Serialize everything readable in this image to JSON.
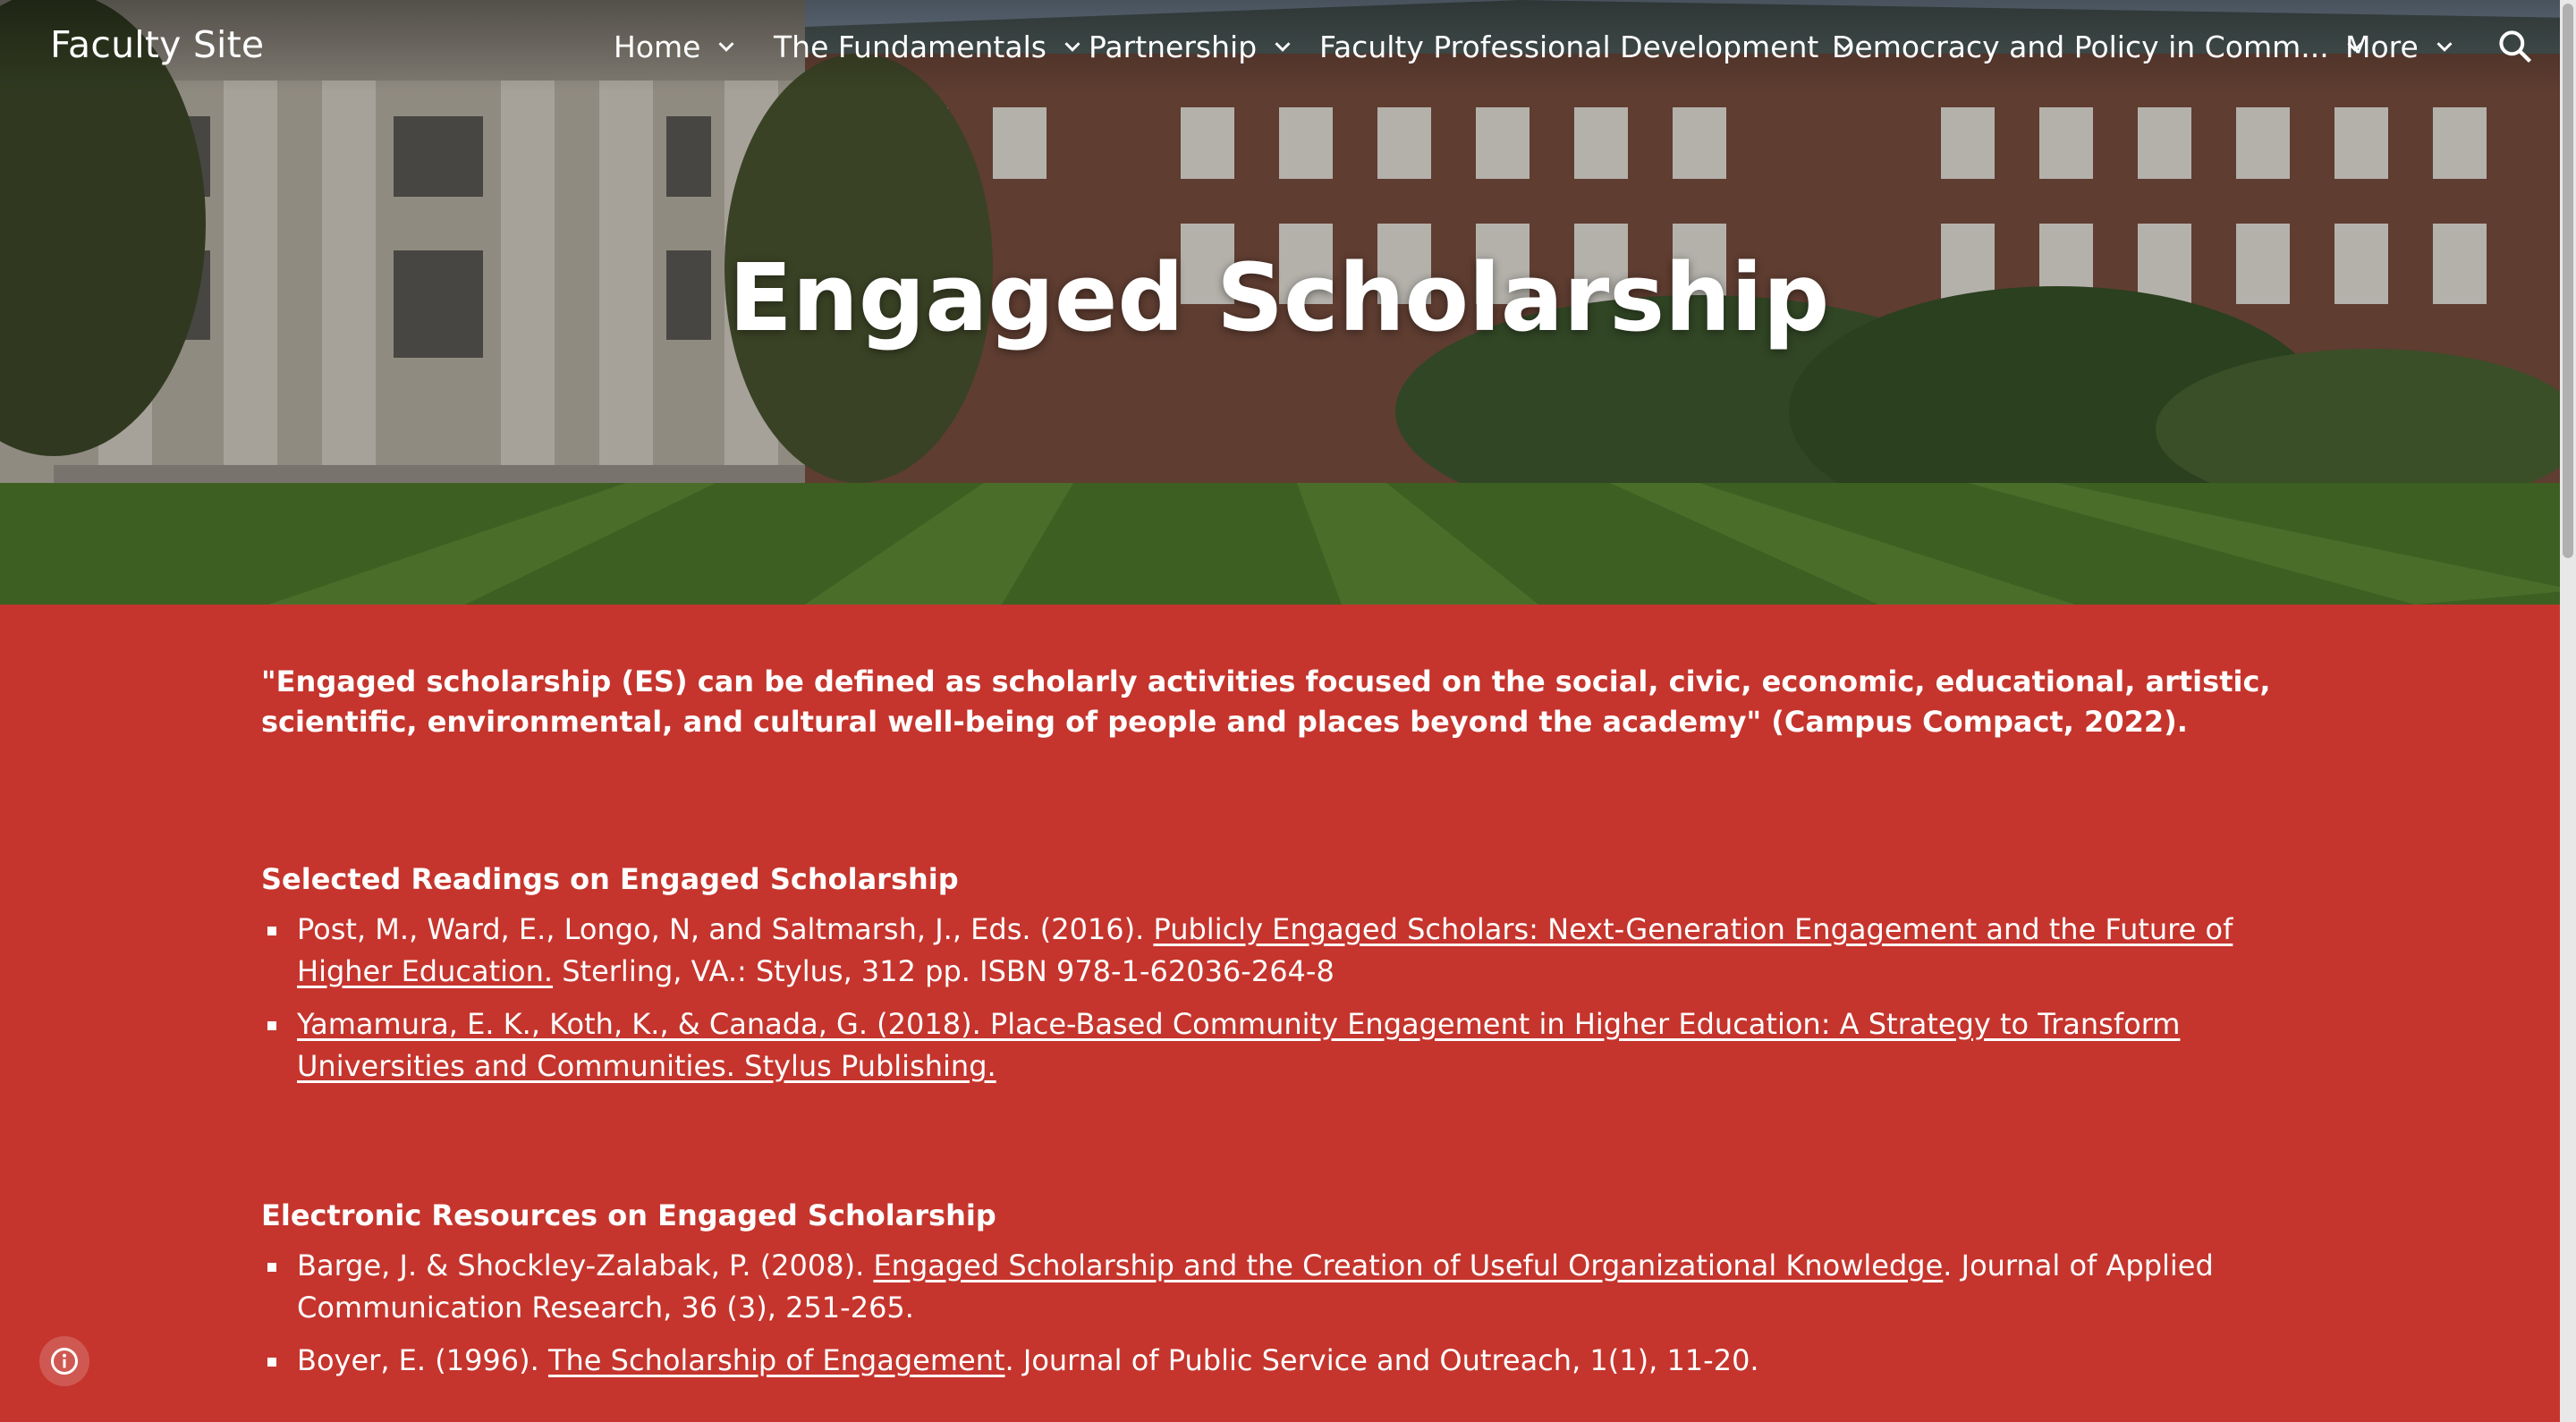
{
  "site": {
    "title": "Faculty Site"
  },
  "nav": {
    "items": [
      {
        "label": "Home"
      },
      {
        "label": "The Fundamentals"
      },
      {
        "label": "Partnership"
      },
      {
        "label": "Faculty Professional Development"
      },
      {
        "label": "Democracy and Policy in Comm..."
      },
      {
        "label": "More"
      }
    ],
    "search_icon": "search-icon",
    "chevron_icon": "chevron-down-icon"
  },
  "hero": {
    "title": "Engaged Scholarship"
  },
  "intro": {
    "quote": "\"Engaged scholarship (ES) can be defined as scholarly activities focused on the social, civic, economic, educational, artistic, scientific, environmental, and cultural well-being of people and places beyond the academy\" (Campus Compact, 2022)."
  },
  "readings": {
    "heading": "Selected Readings on Engaged Scholarship",
    "items": [
      {
        "prefix": "Post, M., Ward, E., Longo, N, and Saltmarsh, J., Eds. (2016). ",
        "link": "Publicly Engaged Scholars: Next-Generation Engagement and the Future of Higher Education.",
        "suffix": " Sterling, VA.: Stylus, 312 pp. ISBN 978-1-62036-264-8"
      },
      {
        "prefix": "",
        "link": "Yamamura, E. K., Koth, K., & Canada, G. (2018). Place-Based Community Engagement in Higher Education: A Strategy to Transform Universities and Communities. Stylus Publishing.",
        "suffix": ""
      }
    ]
  },
  "electronic": {
    "heading": "Electronic Resources on Engaged Scholarship",
    "items": [
      {
        "prefix": "Barge, J. & Shockley-Zalabak, P. (2008). ",
        "link": "Engaged Scholarship and the Creation of Useful Organizational Knowledge",
        "suffix": ". Journal of Applied Communication Research, 36 (3), 251-265."
      },
      {
        "prefix": "Boyer, E. (1996). ",
        "link": "The Scholarship of Engagement",
        "suffix": ". Journal of Public Service and Outreach, 1(1), 11-20."
      }
    ]
  },
  "footer": {
    "info_icon": "info-icon"
  },
  "colors": {
    "content_bg": "#c5352d",
    "text": "#ffffff"
  }
}
